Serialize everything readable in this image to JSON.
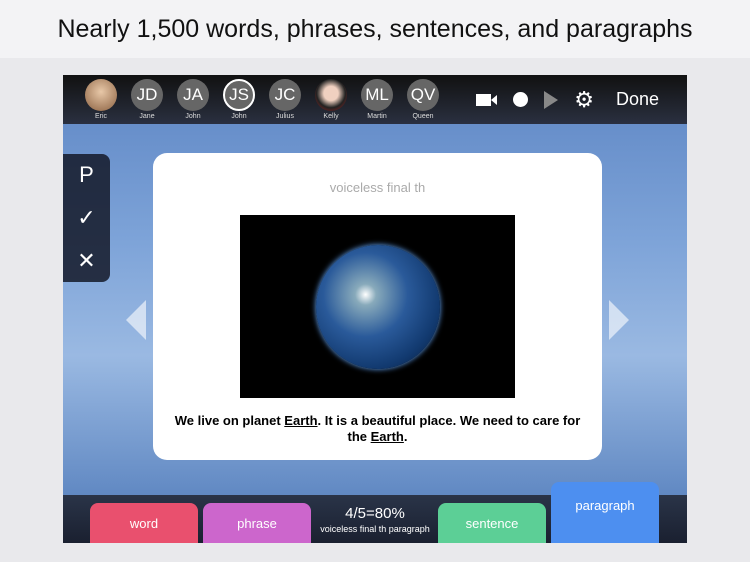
{
  "caption": "Nearly 1,500 words, phrases, sentences, and paragraphs",
  "users": [
    {
      "initials": "",
      "name": "Eric",
      "photo": true
    },
    {
      "initials": "JD",
      "name": "Jane"
    },
    {
      "initials": "JA",
      "name": "John"
    },
    {
      "initials": "JS",
      "name": "John",
      "selected": true
    },
    {
      "initials": "JC",
      "name": "Julius"
    },
    {
      "initials": "",
      "name": "Kelly",
      "photo": true
    },
    {
      "initials": "ML",
      "name": "Martin"
    },
    {
      "initials": "QV",
      "name": "Queen"
    }
  ],
  "controls": {
    "done": "Done",
    "icons": [
      "video-camera-icon",
      "record-icon",
      "play-icon",
      "gear-icon"
    ]
  },
  "side": {
    "p": "P",
    "check": "✓",
    "cross": "✕"
  },
  "card": {
    "title": "voiceless final th",
    "sentence_1": "We live on planet ",
    "word_1": "Earth",
    "sentence_2": ". It is a beautiful place. We need to care for the ",
    "word_2": "Earth",
    "sentence_3": "."
  },
  "bottom": {
    "word": "word",
    "phrase": "phrase",
    "score": "4/5=80%",
    "score_sub": "voiceless final th paragraph",
    "sentence": "sentence",
    "paragraph": "paragraph"
  },
  "colors": {
    "word": "#e9506e",
    "phrase": "#cc66cc",
    "sentence": "#5ccf96",
    "paragraph": "#4d8ff0"
  }
}
